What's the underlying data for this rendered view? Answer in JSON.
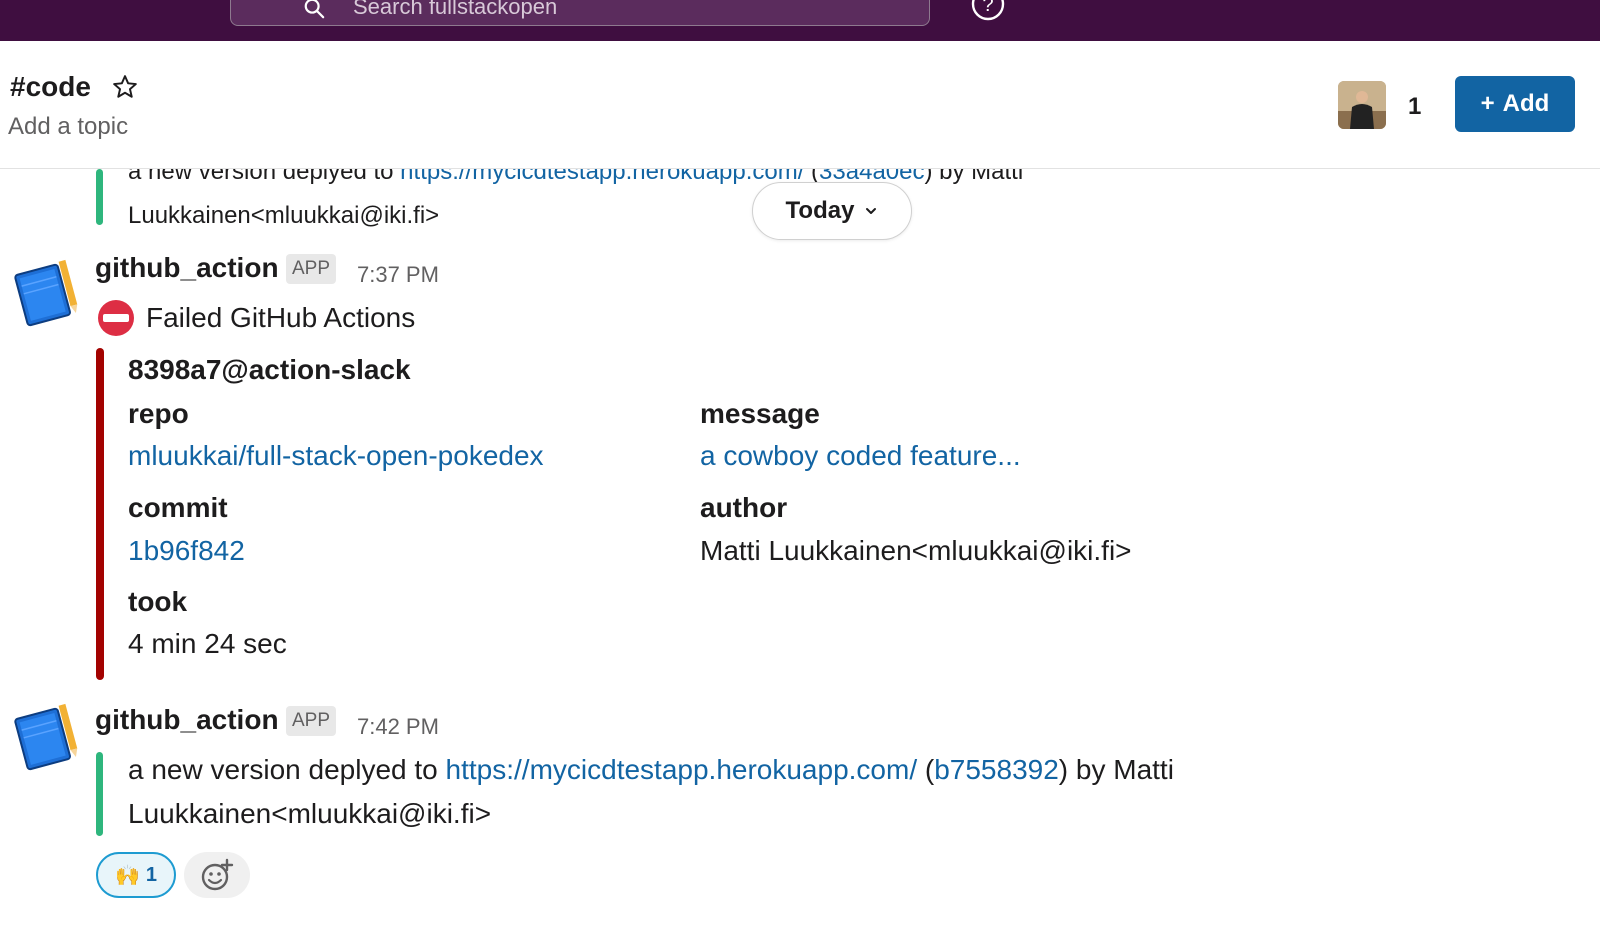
{
  "topbar": {
    "search_placeholder": "Search fullstackopen",
    "help_icon": "help-circle-icon"
  },
  "channel": {
    "name": "#code",
    "topic": "Add a topic",
    "member_count": "1",
    "add_label": "Add"
  },
  "previous_message": {
    "text_before": "a new version deplyed to ",
    "link": "https://mycicdtestapp.herokuapp.com/",
    "middle": "  (",
    "commit": "33a4a0ec",
    "after": ") by Matti",
    "line2": "Luukkainen<mluukkai@iki.fi>"
  },
  "divider": {
    "label": "Today"
  },
  "messages": [
    {
      "sender": "github_action",
      "badge": "APP",
      "time": "7:37 PM",
      "headline": "Failed GitHub Actions",
      "status_color": "#a30200",
      "attachment": {
        "title": "8398a7@action-slack",
        "fields": [
          {
            "label": "repo",
            "value": "mluukkai/full-stack-open-pokedex"
          },
          {
            "label": "message",
            "value": "a cowboy coded feature..."
          },
          {
            "label": "commit",
            "value": "1b96f842"
          },
          {
            "label": "author",
            "value": "Matti Luukkainen<mluukkai@iki.fi>"
          },
          {
            "label": "took",
            "value": "4 min 24 sec"
          }
        ]
      }
    },
    {
      "sender": "github_action",
      "badge": "APP",
      "time": "7:42 PM",
      "status_color": "#2eb67d",
      "text_before": "a new version deplyed to ",
      "link": "https://mycicdtestapp.herokuapp.com/",
      "middle": "  (",
      "commit": "b7558392",
      "after": ") by Matti",
      "line2": "Luukkainen<mluukkai@iki.fi>",
      "reactions": [
        {
          "emoji": "🙌",
          "count": "1"
        }
      ]
    }
  ],
  "colors": {
    "topbar": "#3f0e40",
    "accent": "#1264a3",
    "success": "#2eb67d",
    "danger": "#a30200"
  }
}
